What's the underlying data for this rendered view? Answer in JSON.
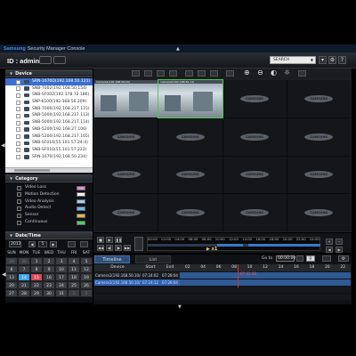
{
  "window": {
    "brand": "Samsung",
    "title_rest": "Security Manager Console"
  },
  "header": {
    "user_label": "ID : admin",
    "search_placeholder": "SEARCH"
  },
  "device_panel": {
    "title": "Device",
    "devices": [
      "SRN-1670D(192.168.50.121)",
      "SNB-7002(192.168.50.154)",
      "SNB-SF002(192.178.72.186)",
      "SNP-6100(192.168.50.209)",
      "SNB-7000(192.168.217.115)",
      "SNB-5000(192.168.217.113)",
      "SNB-5000(192.168.217.114)",
      "SNB-5200(192.168.27.106)",
      "SNB-5200(192.168.217.165)",
      "SNB-SF016(55.101.57.24:4)",
      "SNB-SF016(55.101.57.222)",
      "SRN-1670(192.168.50.234)"
    ]
  },
  "category_panel": {
    "title": "Category",
    "items": [
      {
        "label": "Video Loss",
        "color": "#e58bd2"
      },
      {
        "label": "Motion Detection",
        "color": "#f0f0f0"
      },
      {
        "label": "Video Analysis",
        "color": "#9ad3f0"
      },
      {
        "label": "Audio Detect",
        "color": "#6fb7f5"
      },
      {
        "label": "Sensor",
        "color": "#e6b94a"
      },
      {
        "label": "Continuous",
        "color": "#44d466"
      }
    ]
  },
  "datetime_panel": {
    "title": "Date/Time",
    "year": "2012",
    "month": "5",
    "weekdays": [
      "SUN",
      "MON",
      "TUE",
      "WED",
      "THU",
      "FRI",
      "SAT"
    ],
    "weeks": [
      [
        "29",
        "30",
        "1",
        "2",
        "3",
        "4",
        "5"
      ],
      [
        "6",
        "7",
        "8",
        "9",
        "10",
        "11",
        "12"
      ],
      [
        "13",
        "14",
        "15",
        "16",
        "17",
        "18",
        "19"
      ],
      [
        "20",
        "21",
        "22",
        "23",
        "24",
        "25",
        "26"
      ],
      [
        "27",
        "28",
        "29",
        "30",
        "31",
        "1",
        "2"
      ]
    ]
  },
  "video_tiles": [
    {
      "label": "Camera1(192.168.50.10)"
    },
    {
      "label": "Camera2(192.168.50.11)"
    }
  ],
  "tile_logo": "SAMSUNG",
  "timeline": {
    "hours": [
      "00:00",
      "02:00",
      "04:00",
      "06:00",
      "08:00",
      "10:00",
      "12:00",
      "14:00",
      "16:00",
      "18:00",
      "20:00",
      "22:00",
      "24:00"
    ],
    "speed": "x1",
    "tab_timeline": "Timeline",
    "tab_list": "List",
    "goto_label": "Go to",
    "goto_value": "00:00:00",
    "cols": {
      "device": "Device",
      "start": "Start",
      "end": "End"
    },
    "hour_ticks": [
      "02",
      "04",
      "06",
      "08",
      "10",
      "12",
      "14",
      "16",
      "18",
      "20",
      "22"
    ],
    "rows": [
      {
        "device": "Camera1(192.168.50.10/4...",
        "start": "07:24:02",
        "end": "07:28:04"
      },
      {
        "device": "Camera1(192.168.50.10/1...",
        "start": "07:24:12",
        "end": "07:28:04"
      }
    ],
    "cursor_time": "07:31:58"
  }
}
